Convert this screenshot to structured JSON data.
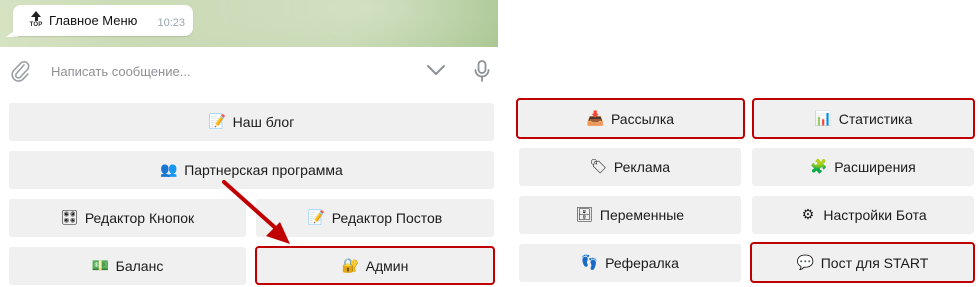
{
  "chat": {
    "message_text": "Главное Меню",
    "message_time": "10:23",
    "top_badge": "TOP",
    "composer_placeholder": "Написать сообщение..."
  },
  "left_keyboard": [
    {
      "label": "Наш блог",
      "icon": "memo-icon",
      "highlighted": false
    },
    {
      "label": "Партнерская программа",
      "icon": "people-icon",
      "highlighted": false
    },
    {
      "label": "Редактор Кнопок",
      "icon": "control-knobs-icon",
      "highlighted": false
    },
    {
      "label": "Редактор Постов",
      "icon": "memo-icon",
      "highlighted": false
    },
    {
      "label": "Баланс",
      "icon": "money-icon",
      "highlighted": false
    },
    {
      "label": "Админ",
      "icon": "lock-with-key-icon",
      "highlighted": true
    }
  ],
  "right_keyboard": [
    {
      "label": "Рассылка",
      "icon": "inbox-tray-icon",
      "highlighted": true
    },
    {
      "label": "Статистика",
      "icon": "bar-chart-icon",
      "highlighted": true
    },
    {
      "label": "Реклама",
      "icon": "label-tag-icon",
      "highlighted": false
    },
    {
      "label": "Расширения",
      "icon": "puzzle-piece-icon",
      "highlighted": false
    },
    {
      "label": "Переменные",
      "icon": "file-cabinet-icon",
      "highlighted": false
    },
    {
      "label": "Настройки Бота",
      "icon": "gear-icon",
      "highlighted": false
    },
    {
      "label": "Рефералка",
      "icon": "footprints-icon",
      "highlighted": false
    },
    {
      "label": "Пост для START",
      "icon": "speech-balloon-icon",
      "highlighted": true
    }
  ],
  "colors": {
    "highlight_border": "#c00000",
    "annotation_arrow": "#c00000",
    "button_bg": "#f0f0f0"
  }
}
